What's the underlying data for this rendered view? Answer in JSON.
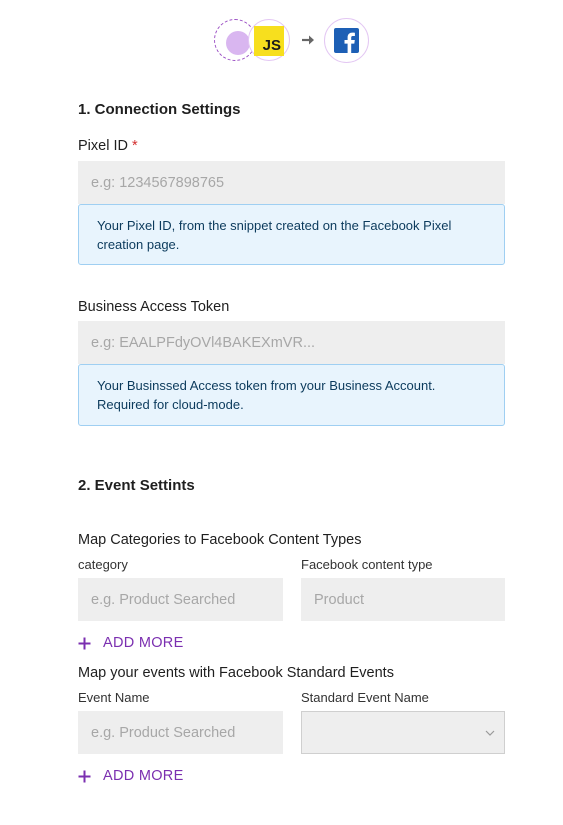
{
  "header": {
    "source_icon": "source-circle-icon",
    "js_badge_text": "JS",
    "arrow_icon": "arrow-right-icon",
    "destination_icon": "facebook-icon",
    "accent_color": "#7b2fb0"
  },
  "connection": {
    "title": "1. Connection Settings",
    "pixel_id": {
      "label": "Pixel ID",
      "required_mark": "*",
      "placeholder": "e.g: 1234567898765",
      "help": "Your Pixel ID, from the snippet created on the Facebook Pixel creation page."
    },
    "access_token": {
      "label": "Business Access Token",
      "placeholder": "e.g: EAALPFdyOVl4BAKEXmVR...",
      "help": "Your Businssed Access token from your Business Account. Required for cloud-mode."
    }
  },
  "events": {
    "title": "2. Event Settints",
    "category_map": {
      "heading": "Map Categories to Facebook Content Types",
      "col1_label": "category",
      "col2_label": "Facebook content type",
      "col1_placeholder": "e.g. Product Searched",
      "col2_placeholder": "Product",
      "add_more": "ADD MORE"
    },
    "event_map": {
      "heading": "Map your events with Facebook Standard Events",
      "col1_label": "Event Name",
      "col2_label": "Standard Event Name",
      "col1_placeholder": "e.g. Product Searched",
      "col2_value": "",
      "add_more": "ADD MORE"
    }
  }
}
